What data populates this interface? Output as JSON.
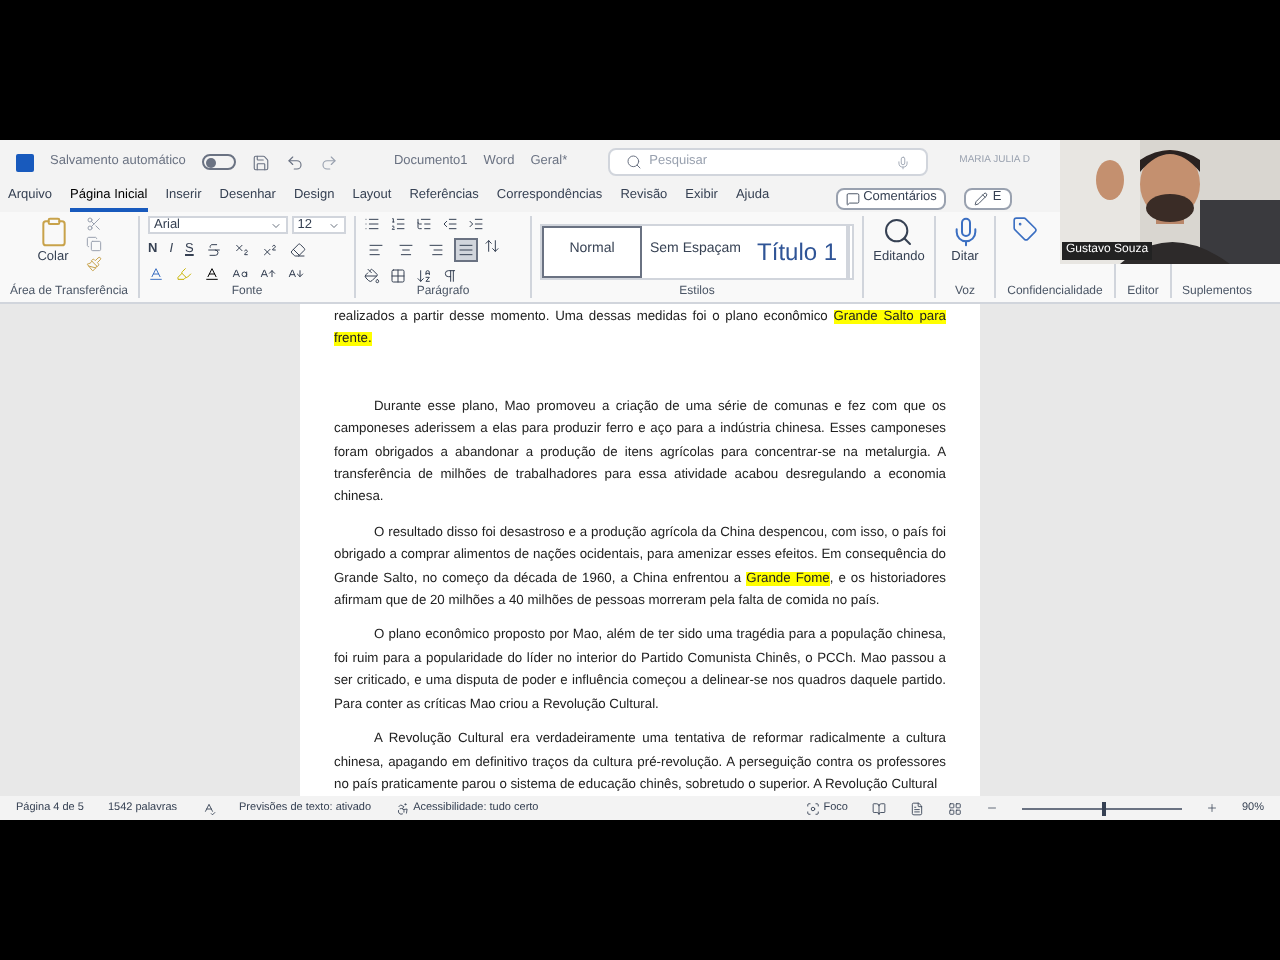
{
  "title_bar": {
    "autosave_label": "Salvamento automático",
    "autosave_on": false,
    "document": "Documento1",
    "app": "Word",
    "sensitivity": "Geral*",
    "search": {
      "placeholder": "Pesquisar"
    },
    "user": "MARIA JULIA D"
  },
  "menu_tabs": [
    {
      "label": "Arquivo",
      "selected": false
    },
    {
      "label": "Página Inicial",
      "selected": true
    },
    {
      "label": "Inserir",
      "selected": false
    },
    {
      "label": "Desenhar",
      "selected": false
    },
    {
      "label": "Design",
      "selected": false
    },
    {
      "label": "Layout",
      "selected": false
    },
    {
      "label": "Referências",
      "selected": false
    },
    {
      "label": "Correspondências",
      "selected": false
    },
    {
      "label": "Revisão",
      "selected": false
    },
    {
      "label": "Exibir",
      "selected": false
    },
    {
      "label": "Ajuda",
      "selected": false
    }
  ],
  "comments_button": "Comentários",
  "editing_button": "E",
  "ribbon": {
    "clipboard": {
      "paste": "Colar",
      "label": "Área de Transferência"
    },
    "font": {
      "name": "Arial",
      "size": "12",
      "bold": "N",
      "italic": "I",
      "underline": "S",
      "label": "Fonte"
    },
    "paragraph": {
      "align_buttons": [
        {
          "kind": "left",
          "selected": false
        },
        {
          "kind": "center",
          "selected": false
        },
        {
          "kind": "right",
          "selected": false
        },
        {
          "kind": "justify",
          "selected": true
        }
      ],
      "label": "Parágrafo"
    },
    "styles": {
      "items": [
        {
          "label": "Normal",
          "selected": true
        },
        {
          "label": "Sem Espaçam",
          "selected": false
        },
        {
          "label": "Título 1",
          "selected": false
        }
      ],
      "label": "Estilos"
    },
    "editing": "Editando",
    "dictate": "Ditar",
    "voice": "Voz",
    "sensitivity": "Confidencialidade",
    "editor": "Editor",
    "addins": "Suplementos"
  },
  "document": {
    "paragraphs": [
      {
        "indent": false,
        "runs": [
          {
            "text": "realizados a partir desse momento. Uma dessas medidas foi o plano econômico ",
            "highlight": false
          },
          {
            "text": "Grande Salto para frente.",
            "highlight": true
          }
        ]
      },
      {
        "indent": true,
        "runs": [
          {
            "text": "Durante esse plano, Mao promoveu a criação de uma série de comunas e fez com que os camponeses aderissem a elas para produzir ferro e aço para a indústria chinesa. Esses camponeses foram obrigados a abandonar a produção de itens agrícolas para concentrar-se na metalurgia. A transferência de milhões de trabalhadores para essa atividade acabou desregulando a economia chinesa.",
            "highlight": false
          }
        ]
      },
      {
        "indent": true,
        "runs": [
          {
            "text": "O resultado disso foi desastroso e a produção agrícola da China despencou, com isso, o país foi obrigado a comprar alimentos de nações ocidentais, para amenizar esses efeitos. Em consequência do Grande Salto, no começo da década de 1960, a China enfrentou a ",
            "highlight": false
          },
          {
            "text": "Grande Fome",
            "highlight": true
          },
          {
            "text": ", e os historiadores afirmam que de 20 milhões a 40 milhões de pessoas morreram pela falta de comida no país.",
            "highlight": false
          }
        ]
      },
      {
        "indent": true,
        "runs": [
          {
            "text": "O plano econômico proposto por Mao, além de ter sido uma tragédia para a população chinesa, foi ruim para a popularidade do líder no interior do Partido Comunista Chinês, o PCCh. Mao passou a ser criticado, e uma disputa de poder e influência começou a delinear-se nos quadros daquele partido. Para conter as críticas Mao criou a Revolução Cultural.",
            "highlight": false
          }
        ]
      },
      {
        "indent": true,
        "runs": [
          {
            "text": "A Revolução Cultural era verdadeiramente uma tentativa de reformar radicalmente a cultura chinesa, apagando em definitivo traços da cultura pré-revolução. A perseguição contra os professores no país praticamente parou o sistema de educação chinês, sobretudo o superior. A Revolução Cultural",
            "highlight": false
          }
        ]
      }
    ]
  },
  "status_bar": {
    "page": "Página 4 de 5",
    "words": "1542 palavras",
    "predictions": "Previsões de texto: ativado",
    "accessibility": "Acessibilidade: tudo certo",
    "focus": "Foco",
    "zoom": {
      "level": 0.5
    },
    "zoom_reading": "90%"
  },
  "video_overlay": {
    "kind": "picture",
    "name": "Gustavo Souza"
  }
}
